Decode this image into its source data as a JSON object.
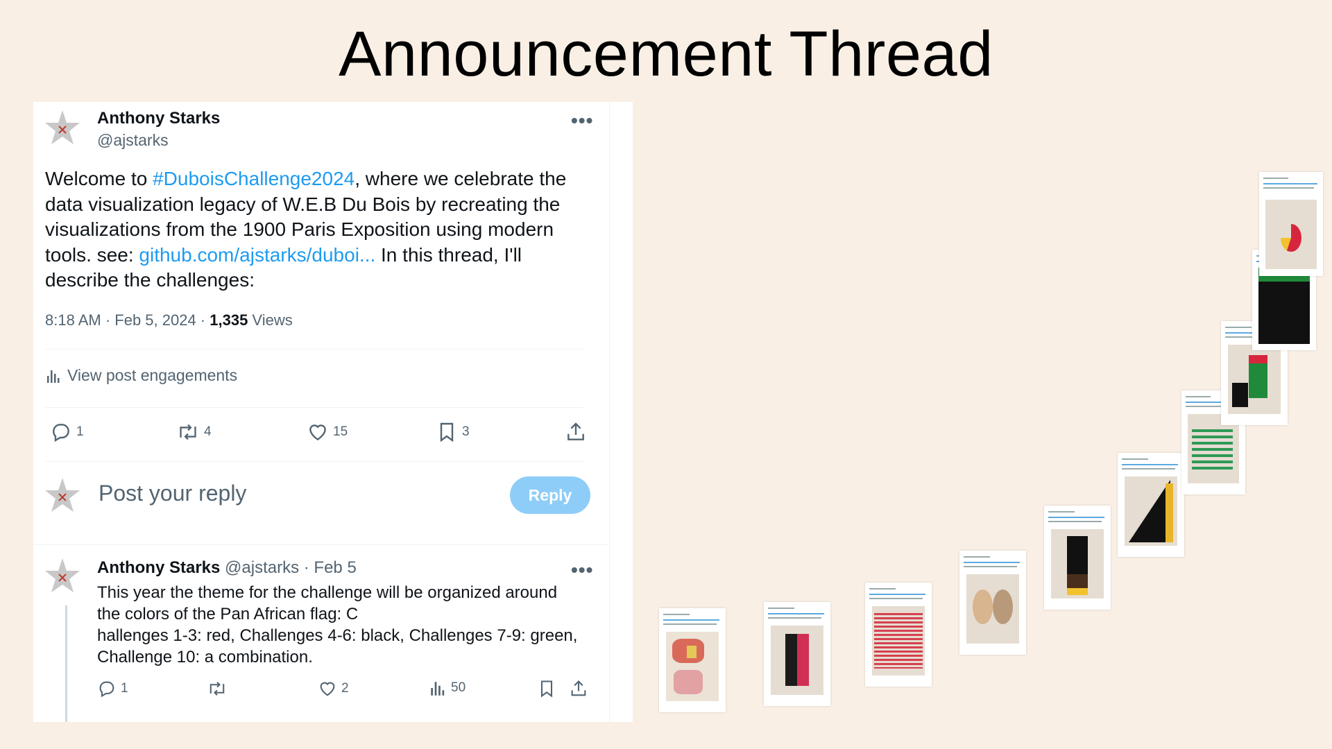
{
  "slide": {
    "title": "Announcement Thread"
  },
  "tweet": {
    "author_name": "Anthony Starks",
    "author_handle": "@ajstarks",
    "text_before": "Welcome to ",
    "hashtag": "#DuboisChallenge2024",
    "text_middle": ", where we celebrate the data visualization legacy of W.E.B Du Bois by recreating the visualizations from the 1900 Paris Exposition using modern tools.  see: ",
    "link": "github.com/ajstarks/duboi...",
    "text_after": "  In this thread, I'll describe the challenges:",
    "timestamp": "8:18 AM · Feb 5, 2024 · ",
    "views_count": "1,335",
    "views_label": " Views",
    "engagements_label": "View post engagements",
    "stats": {
      "replies": "1",
      "reposts": "4",
      "likes": "15",
      "bookmarks": "3"
    }
  },
  "reply_box": {
    "placeholder": "Post your reply",
    "button_label": "Reply"
  },
  "thread_reply": {
    "author_name": "Anthony Starks",
    "author_handle_date": " @ajstarks · Feb 5",
    "text_line1": "This year the theme for the challenge will be organized around",
    "text_line2": "the colors of the Pan African flag: C",
    "text_line3": "hallenges 1-3: red, Challenges 4-6: black, Challenges 7-9: green,",
    "text_line4": "Challenge 10: a combination.",
    "stats": {
      "replies": "1",
      "reposts": "",
      "likes": "2",
      "views": "50"
    }
  },
  "colors": {
    "accent": "#1d9bf0",
    "background": "#f9efe5",
    "reply_button": "#8ecdf8"
  },
  "icons": [
    "star-avatar-icon",
    "more-icon",
    "analytics-icon",
    "reply-icon",
    "repost-icon",
    "like-icon",
    "bookmark-icon",
    "share-icon"
  ]
}
